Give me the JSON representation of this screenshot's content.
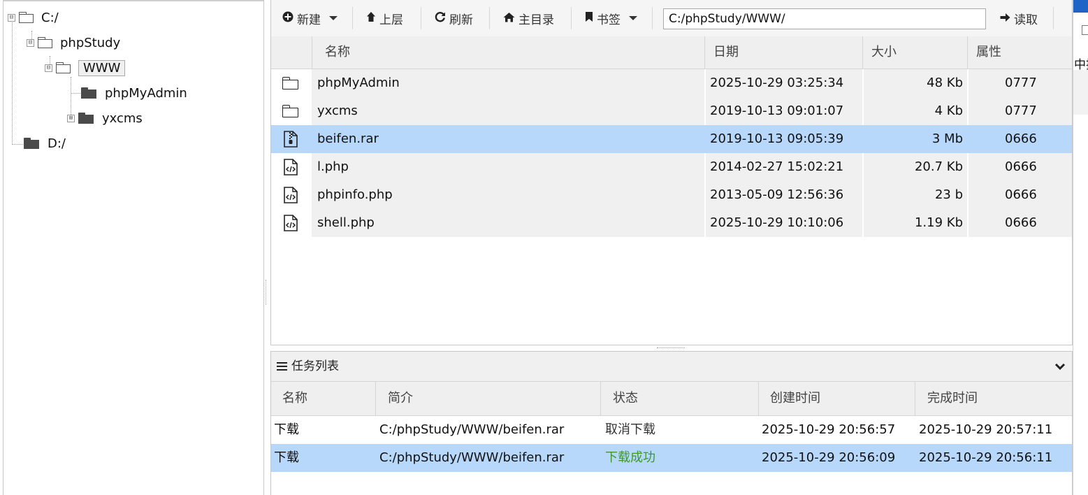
{
  "tree": {
    "nodes": [
      {
        "label": "C:/",
        "expander": "⊟"
      },
      {
        "label": "phpStudy",
        "expander": "⊟"
      },
      {
        "label": "WWW",
        "expander": "⊟"
      },
      {
        "label": "phpMyAdmin"
      },
      {
        "label": "yxcms",
        "expander": "⊞"
      },
      {
        "label": "D:/"
      }
    ]
  },
  "toolbar": {
    "new_label": "新建",
    "up_label": "上层",
    "refresh_label": "刷新",
    "home_label": "主目录",
    "bookmark_label": "书签",
    "path_value": "C:/phpStudy/WWW/",
    "read_label": "读取"
  },
  "file_table": {
    "columns": [
      "名称",
      "日期",
      "大小",
      "属性"
    ],
    "rows": [
      {
        "type": "folder",
        "name": "phpMyAdmin",
        "date": "2025-10-29 03:25:34",
        "size": "48 Kb",
        "attr": "0777"
      },
      {
        "type": "folder",
        "name": "yxcms",
        "date": "2019-10-13 09:01:07",
        "size": "4 Kb",
        "attr": "0777"
      },
      {
        "type": "archive",
        "name": "beifen.rar",
        "date": "2019-10-13 09:05:39",
        "size": "3 Mb",
        "attr": "0666",
        "selected": true
      },
      {
        "type": "code",
        "name": "l.php",
        "date": "2014-02-27 15:02:21",
        "size": "20.7 Kb",
        "attr": "0666"
      },
      {
        "type": "code",
        "name": "phpinfo.php",
        "date": "2013-05-09 12:56:36",
        "size": "23 b",
        "attr": "0666"
      },
      {
        "type": "code",
        "name": "shell.php",
        "date": "2025-10-29 10:10:06",
        "size": "1.19 Kb",
        "attr": "0666"
      }
    ]
  },
  "task_panel": {
    "title": "任务列表",
    "columns": [
      "名称",
      "简介",
      "状态",
      "创建时间",
      "完成时间"
    ],
    "rows": [
      {
        "name": "下载",
        "desc": "C:/phpStudy/WWW/beifen.rar",
        "status": "取消下载",
        "created": "2025-10-29 20:56:57",
        "finished": "2025-10-29 20:57:11"
      },
      {
        "name": "下载",
        "desc": "C:/phpStudy/WWW/beifen.rar",
        "status": "下载成功",
        "created": "2025-10-29 20:56:09",
        "finished": "2025-10-29 20:56:11",
        "selected": true
      }
    ]
  },
  "edge": {
    "text": "中控"
  },
  "colors": {
    "selection": "#b8d8fb",
    "success": "#3a9a2a",
    "edge_blue": "#1e63c6"
  }
}
